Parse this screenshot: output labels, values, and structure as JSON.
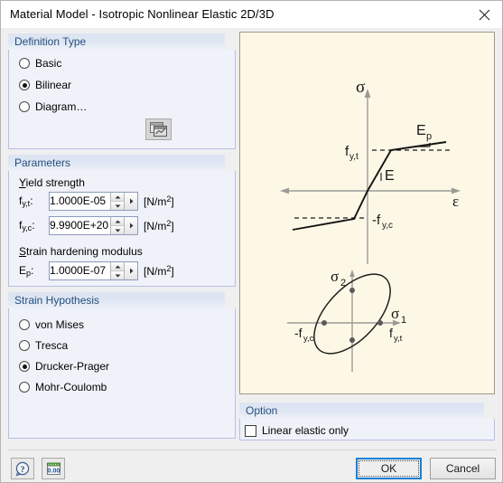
{
  "window": {
    "title": "Material Model - Isotropic Nonlinear Elastic 2D/3D",
    "close_icon": "close-icon"
  },
  "definition_type": {
    "legend": "Definition Type",
    "options": [
      {
        "label_pre": "Ba",
        "label_key": "s",
        "label_post": "ic",
        "label": "Basic",
        "selected": false
      },
      {
        "label_pre": "",
        "label_key": "B",
        "label_post": "ilinear",
        "label": "Bilinear",
        "selected": true
      },
      {
        "label_pre": "D",
        "label_key": "i",
        "label_post": "agram…",
        "label": "Diagram…",
        "selected": false
      }
    ],
    "diagram_button_icon": "diagram-window-icon"
  },
  "parameters": {
    "legend": "Parameters",
    "yield_strength_label": "Yield strength",
    "yield_strength_label_key": "Y",
    "yield_strength_label_rest": "ield strength",
    "strain_hardening_label": "Strain hardening modulus",
    "strain_hardening_label_key": "S",
    "strain_hardening_label_rest": "train hardening modulus",
    "fields": [
      {
        "name": "f-y-t",
        "symbol": "f",
        "subscript": "y,t",
        "colon": ":",
        "value": "1.0000E-05",
        "unit_main": "[N/m",
        "unit_exp": "2",
        "unit_close": "]"
      },
      {
        "name": "f-y-c",
        "symbol": "f",
        "subscript": "y,c",
        "colon": ":",
        "value": "9.9900E+20",
        "unit_main": "[N/m",
        "unit_exp": "2",
        "unit_close": "]"
      },
      {
        "name": "e-p",
        "symbol": "E",
        "subscript": "p",
        "colon": ":",
        "value": "1.0000E-07",
        "unit_main": "[N/m",
        "unit_exp": "2",
        "unit_close": "]"
      }
    ]
  },
  "strain_hypothesis": {
    "legend": "Strain Hypothesis",
    "options": [
      {
        "label": "von Mises",
        "label_key": "v",
        "label_rest": "on Mises",
        "selected": false
      },
      {
        "label": "Tresca",
        "label_key": "T",
        "label_rest": "resca",
        "selected": false
      },
      {
        "label": "Drucker-Prager",
        "label_key": "D",
        "label_rest": "rucker-Prager",
        "selected": true
      },
      {
        "label": "Mohr-Coulomb",
        "label_key": "M",
        "label_rest": "ohr-Coulomb",
        "selected": false
      }
    ]
  },
  "graph": {
    "background_color": "#fdf8e6",
    "stress_strain": {
      "y_axis_label": "σ",
      "x_axis_label": "ε",
      "annotations": [
        {
          "name": "yield-tension-label",
          "text": "f",
          "sub": "y,t"
        },
        {
          "name": "yield-compression-label",
          "text": "-f",
          "sub": "y,c"
        },
        {
          "name": "elastic-modulus-label",
          "text": "E"
        },
        {
          "name": "hardening-modulus-label",
          "text": "E",
          "sub": "p"
        }
      ]
    },
    "yield_surface": {
      "x_axis_label": "σ",
      "x_axis_sub": "1",
      "y_axis_label": "σ",
      "y_axis_sub": "2",
      "left_label": "-f",
      "left_sub": "y,c",
      "right_label": "f",
      "right_sub": "y,t"
    }
  },
  "option": {
    "legend": "Option",
    "checkbox": {
      "label": "Linear elastic only",
      "label_key": "L",
      "label_rest": "inear elastic only",
      "checked": false
    }
  },
  "footer": {
    "help_button_icon": "help-question-icon",
    "units_button_icon": "units-numeric-icon",
    "ok_label": "OK",
    "cancel_label": "Cancel"
  },
  "colors": {
    "accent_blue": "#1a7fd4",
    "group_header_text": "#26507f",
    "group_border": "#b9bde8",
    "group_body": "#eff2f8",
    "dialog_bg": "#efefef",
    "graph_bg": "#fdf8e6"
  }
}
